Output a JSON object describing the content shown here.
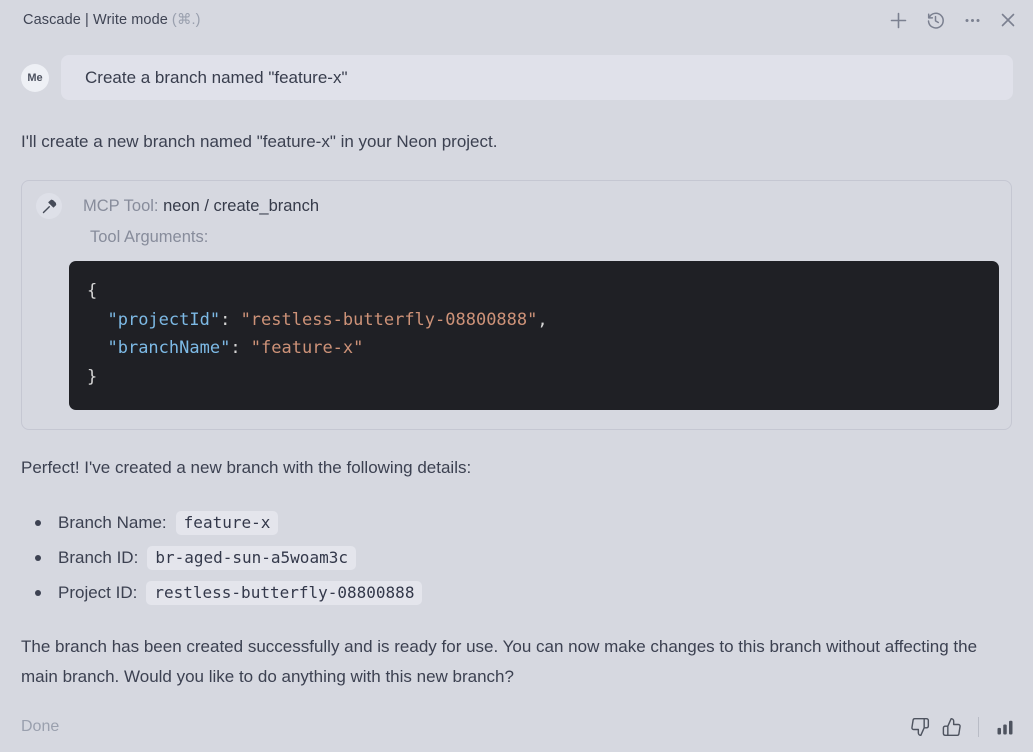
{
  "header": {
    "title": "Cascade | Write mode",
    "shortcut": "(⌘.)",
    "icons": {
      "new": "plus-icon",
      "history": "history-icon",
      "more": "ellipsis-icon",
      "close": "close-icon"
    }
  },
  "user_message": {
    "avatar_label": "Me",
    "text": "Create a branch named \"feature-x\""
  },
  "assistant": {
    "intro": "I'll create a new branch named \"feature-x\" in your Neon project.",
    "tool_card": {
      "label": "MCP Tool: ",
      "tool_name": "neon / create_branch",
      "args_label": "Tool Arguments:",
      "code": {
        "brace_open": "{",
        "brace_close": "}",
        "indent": "  ",
        "entries": [
          {
            "key": "\"projectId\"",
            "sep": ": ",
            "value": "\"restless-butterfly-08800888\"",
            "trail": ","
          },
          {
            "key": "\"branchName\"",
            "sep": ": ",
            "value": "\"feature-x\"",
            "trail": ""
          }
        ]
      }
    },
    "details_intro": "Perfect! I've created a new branch with the following details:",
    "details": [
      {
        "label": "Branch Name:",
        "value": "feature-x"
      },
      {
        "label": "Branch ID:",
        "value": "br-aged-sun-a5woam3c"
      },
      {
        "label": "Project ID:",
        "value": "restless-butterfly-08800888"
      }
    ],
    "outro": "The branch has been created successfully and is ready for use. You can now make changes to this branch without affecting the main branch. Would you like to do anything with this new branch?"
  },
  "footer": {
    "status": "Done"
  },
  "colors": {
    "background": "#d6d8e0",
    "user_bubble": "#e0e1ea",
    "code_background": "#1f2025",
    "code_key": "#7dbae6",
    "code_string": "#cd9278",
    "chip_background": "#e4e5ec",
    "text": "#3c4151",
    "muted": "#878c9b"
  }
}
